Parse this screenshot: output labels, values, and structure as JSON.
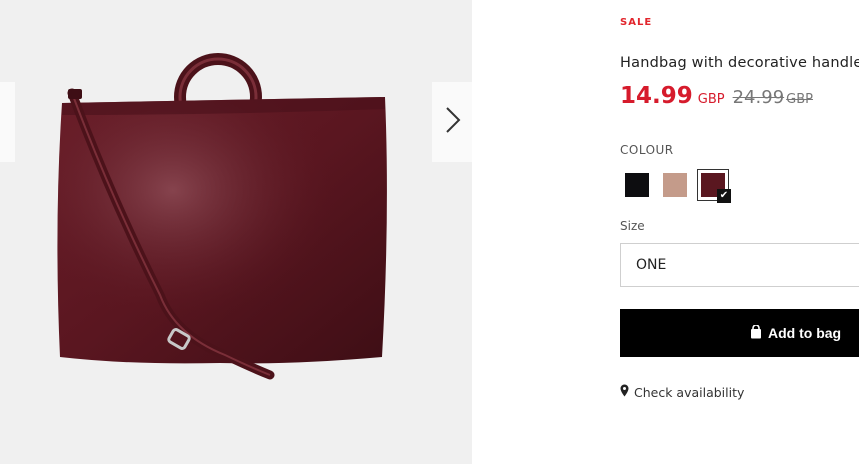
{
  "sale_badge": "SALE",
  "product_title": "Handbag with decorative handle",
  "price": {
    "current": "14.99",
    "currency": "GBP",
    "old": "24.99",
    "old_currency": "GBP"
  },
  "colour": {
    "label": "COLOUR",
    "swatches": [
      {
        "name": "black",
        "color": "#0d0d10",
        "selected": false
      },
      {
        "name": "beige",
        "color": "#c49b8a",
        "selected": false
      },
      {
        "name": "burgundy",
        "color": "#5a1720",
        "selected": true
      }
    ]
  },
  "size": {
    "label": "Size",
    "value": "ONE"
  },
  "actions": {
    "add_to_bag": "Add to bag",
    "check_availability": "Check availability"
  },
  "icons": {
    "gallery_prev": "chevron-left-icon",
    "gallery_next": "chevron-right-icon",
    "bag": "shopping-bag-icon",
    "location": "map-pin-icon",
    "selected": "checkmark-icon"
  },
  "colors": {
    "sale": "#e2252c",
    "price": "#d61b2c",
    "button": "#000000",
    "product": "#5a1620"
  }
}
